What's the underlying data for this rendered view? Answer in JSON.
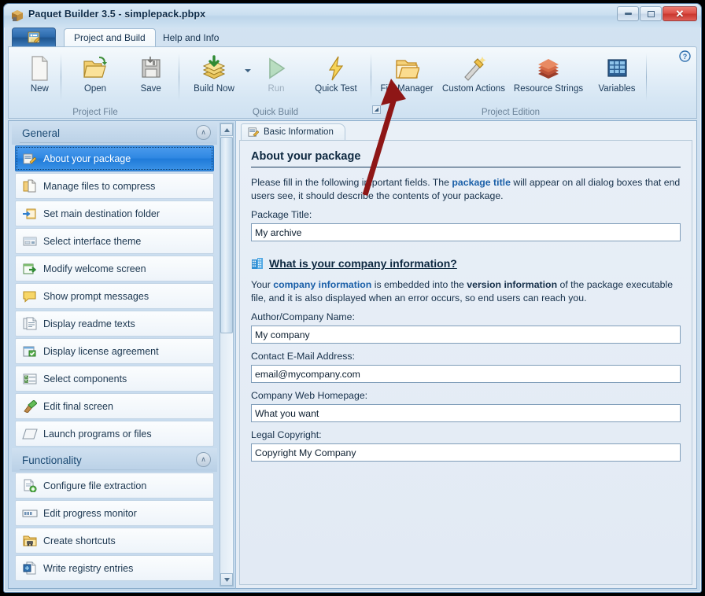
{
  "window": {
    "title": "Paquet Builder 3.5 - simplepack.pbpx",
    "icon": "package-box-icon",
    "controls": [
      {
        "name": "minimize-button",
        "glyph": "minimize"
      },
      {
        "name": "maximize-button",
        "glyph": "maximize"
      },
      {
        "name": "close-button",
        "glyph": "✕"
      }
    ]
  },
  "ribbon": {
    "app_button_label": "",
    "help_label": "?",
    "tabs": [
      {
        "label": "Project and Build",
        "active": true
      },
      {
        "label": "Help and Info",
        "active": false
      }
    ],
    "groups": [
      {
        "label": "Project File",
        "items": [
          {
            "label": "New",
            "icon": "new-document-icon",
            "disabled": false
          },
          {
            "label": "Open",
            "icon": "open-folder-icon",
            "disabled": false
          },
          {
            "label": "Save",
            "icon": "save-disk-icon",
            "disabled": false
          }
        ]
      },
      {
        "label": "Quick Build",
        "items": [
          {
            "label": "Build Now",
            "icon": "build-stack-icon",
            "disabled": false,
            "split": true
          },
          {
            "label": "Run",
            "icon": "run-play-icon",
            "disabled": true
          },
          {
            "label": "Quick Test",
            "icon": "lightning-bolt-icon",
            "disabled": false
          }
        ]
      },
      {
        "label": "Project Edition",
        "items": [
          {
            "label": "File Manager",
            "icon": "file-manager-folder-icon",
            "disabled": false
          },
          {
            "label": "Custom Actions",
            "icon": "custom-actions-wand-icon",
            "disabled": false
          },
          {
            "label": "Resource Strings",
            "icon": "resource-strings-books-icon",
            "disabled": false
          },
          {
            "label": "Variables",
            "icon": "variables-grid-icon",
            "disabled": false
          }
        ]
      }
    ]
  },
  "sidebar": {
    "sections": [
      {
        "title": "General",
        "collapse_glyph": "∧",
        "items": [
          {
            "label": "About your package",
            "icon": "about-package-icon",
            "selected": true
          },
          {
            "label": "Manage files to compress",
            "icon": "manage-files-icon",
            "selected": false
          },
          {
            "label": "Set main destination folder",
            "icon": "destination-folder-icon",
            "selected": false
          },
          {
            "label": "Select interface theme",
            "icon": "interface-theme-icon",
            "selected": false
          },
          {
            "label": "Modify welcome screen",
            "icon": "welcome-screen-icon",
            "selected": false
          },
          {
            "label": "Show prompt messages",
            "icon": "prompt-message-icon",
            "selected": false
          },
          {
            "label": "Display readme texts",
            "icon": "readme-text-icon",
            "selected": false
          },
          {
            "label": "Display license agreement",
            "icon": "license-agreement-icon",
            "selected": false
          },
          {
            "label": "Select components",
            "icon": "select-components-icon",
            "selected": false
          },
          {
            "label": "Edit final screen",
            "icon": "final-screen-icon",
            "selected": false
          },
          {
            "label": "Launch programs or files",
            "icon": "launch-programs-icon",
            "selected": false
          }
        ]
      },
      {
        "title": "Functionality",
        "collapse_glyph": "∧",
        "items": [
          {
            "label": "Configure file extraction",
            "icon": "file-extraction-icon",
            "selected": false
          },
          {
            "label": "Edit progress monitor",
            "icon": "progress-monitor-icon",
            "selected": false
          },
          {
            "label": "Create shortcuts",
            "icon": "create-shortcuts-icon",
            "selected": false
          },
          {
            "label": "Write registry entries",
            "icon": "registry-entries-icon",
            "selected": false
          }
        ]
      }
    ],
    "scroll_up_glyph": "▲",
    "scroll_down_glyph": "▼"
  },
  "main": {
    "tab": {
      "label": "Basic Information",
      "icon": "basic-information-icon"
    },
    "heading": "About your package",
    "intro": {
      "part1": "Please fill in the following important fields. The ",
      "link": "package title",
      "part2": " will appear on all dialog boxes that end users see, it should describe the contents of your package."
    },
    "fields": [
      {
        "label": "Package Title:",
        "value": "My archive",
        "name": "package-title-input"
      }
    ],
    "company_section": {
      "icon": "company-building-icon",
      "heading": "What is your company information?",
      "desc": {
        "p1": "Your ",
        "link1": "company information",
        "p2": " is embedded into the ",
        "bold1": "version information",
        "p3": " of the package executable file, and it is also displayed when an error occurs, so end users can reach you."
      },
      "fields": [
        {
          "label": "Author/Company Name:",
          "value": "My company",
          "name": "author-company-name-input"
        },
        {
          "label": "Contact E-Mail Address:",
          "value": "email@mycompany.com",
          "name": "contact-email-input"
        },
        {
          "label": "Company Web Homepage:",
          "value": "What you want",
          "name": "company-homepage-input"
        },
        {
          "label": "Legal Copyright:",
          "value": "Copyright My Company",
          "name": "legal-copyright-input"
        }
      ]
    }
  },
  "annotation": {
    "type": "arrow",
    "color": "#8e1616",
    "points_to": "File Manager"
  }
}
